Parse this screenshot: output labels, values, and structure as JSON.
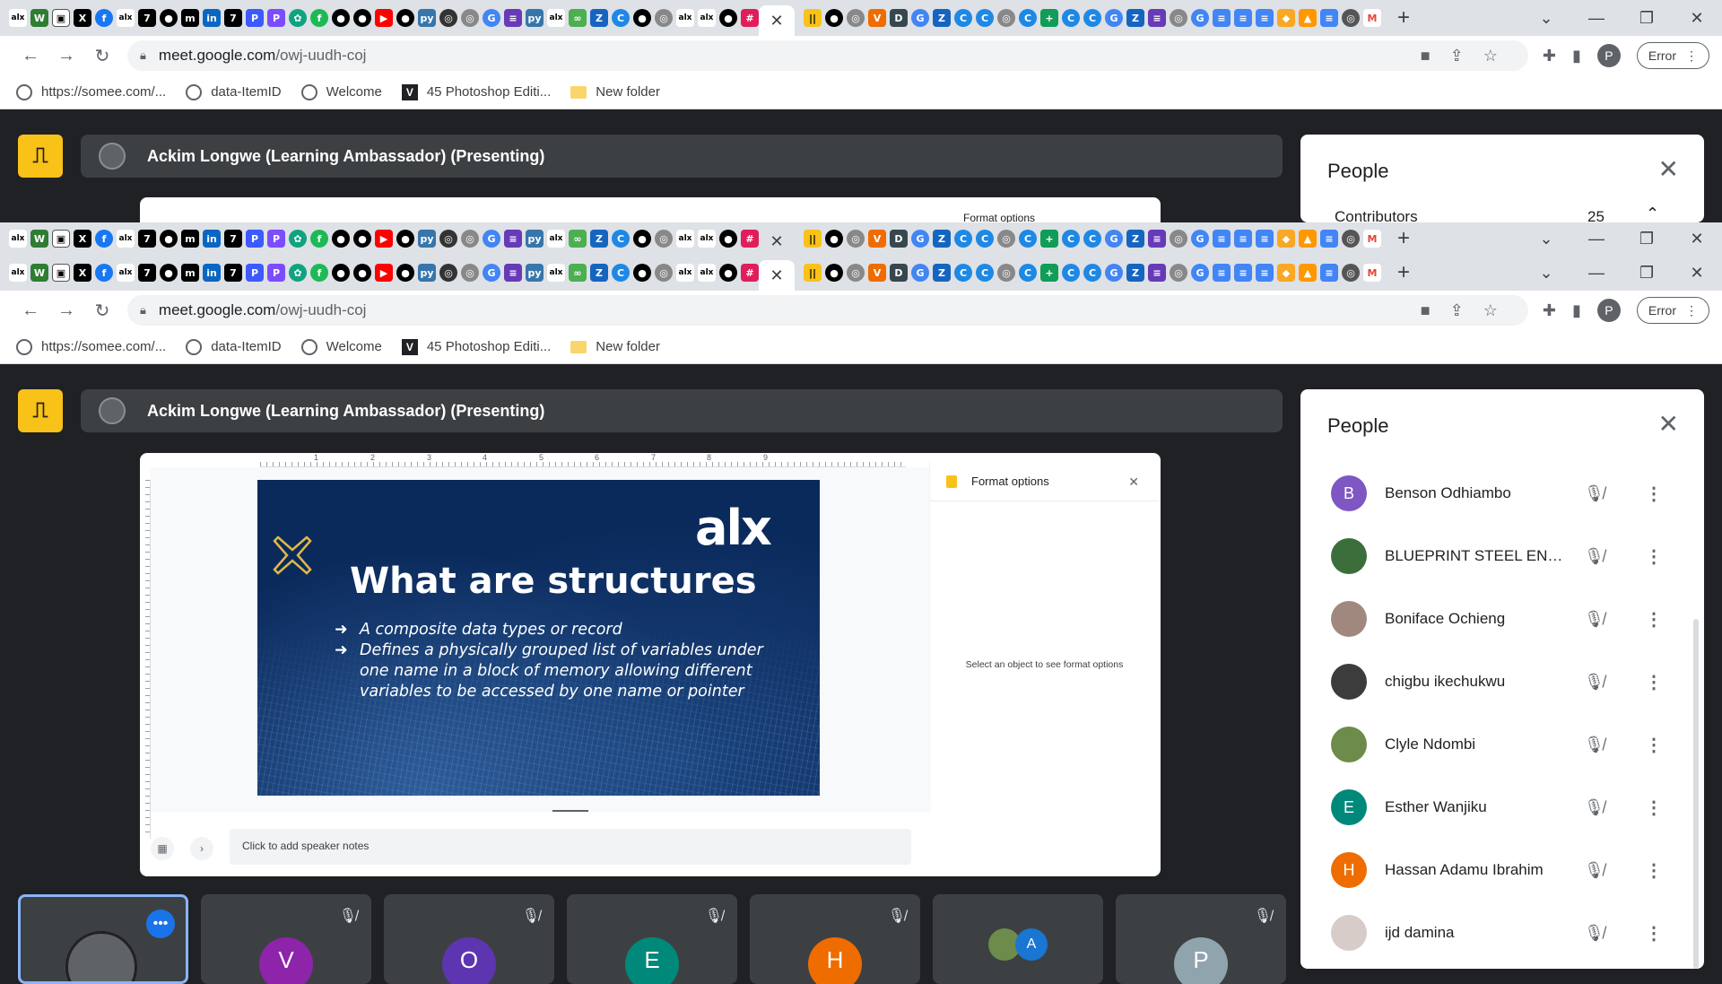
{
  "browser": {
    "url_host": "meet.google.com",
    "url_path": "/owj-uudh-coj",
    "error_label": "Error",
    "profile_initial": "P",
    "bookmarks": [
      "https://somee.com/...",
      "data-ItemID",
      "Welcome",
      "45 Photoshop Editi...",
      "New folder"
    ]
  },
  "meet": {
    "presenting_title": "Ackim Longwe (Learning Ambassador) (Presenting)",
    "people_title": "People",
    "contributors_label": "Contributors",
    "contributors_count": "25"
  },
  "slide": {
    "logo": "alx",
    "title": "What are structures",
    "bullets": [
      "A composite data types or record",
      "Defines a physically grouped list of variables under one name in a block of memory allowing different variables to be accessed by one name or pointer"
    ],
    "ruler_numbers": [
      "1",
      "2",
      "3",
      "4",
      "5",
      "6",
      "7",
      "8",
      "9"
    ],
    "format_title": "Format options",
    "format_message": "Select an object to see format options",
    "notes_placeholder": "Click to add speaker notes"
  },
  "participants": [
    {
      "name": "Benson Odhiambo",
      "initial": "B",
      "color": "#7e57c2"
    },
    {
      "name": "BLUEPRINT STEEL ENGI...",
      "initial": "",
      "color": "#3b6e3b"
    },
    {
      "name": "Boniface Ochieng",
      "initial": "",
      "color": "#a1887f"
    },
    {
      "name": "chigbu ikechukwu",
      "initial": "",
      "color": "#3c3c3c"
    },
    {
      "name": "Clyle Ndombi",
      "initial": "",
      "color": "#6d8b4a"
    },
    {
      "name": "Esther Wanjiku",
      "initial": "E",
      "color": "#00897b"
    },
    {
      "name": "Hassan Adamu Ibrahim",
      "initial": "H",
      "color": "#ef6c00"
    },
    {
      "name": "ijd damina",
      "initial": "",
      "color": "#d7ccc8"
    }
  ],
  "tiles": [
    {
      "initial": "V",
      "color": "#8e24aa"
    },
    {
      "initial": "O",
      "color": "#5e35b1"
    },
    {
      "initial": "E",
      "color": "#00897b"
    },
    {
      "initial": "H",
      "color": "#ef6c00"
    },
    {
      "initial": "A",
      "color": "#1976d2"
    },
    {
      "initial": "P",
      "color": "#90a4ae"
    }
  ],
  "colors": {
    "accent": "#1a73e8",
    "exit": "#f9c218",
    "slide_bg": "#0b2a5c"
  }
}
